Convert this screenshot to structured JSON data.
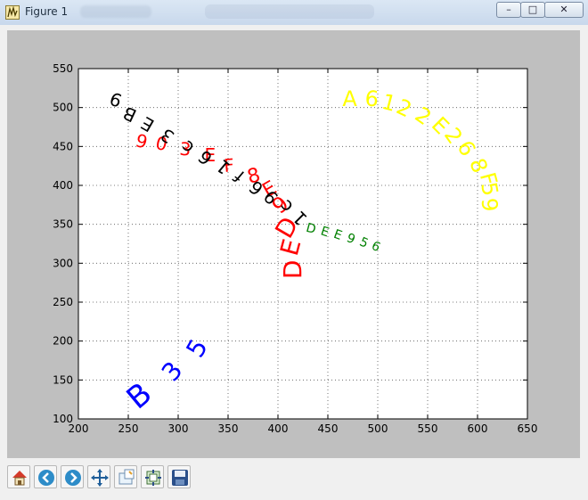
{
  "window": {
    "title": "Figure 1",
    "controls": {
      "minimize": "–",
      "maximize": "□",
      "close": "✕"
    }
  },
  "toolbar": {
    "buttons": [
      "home-icon",
      "back-icon",
      "forward-icon",
      "pan-icon",
      "zoom-icon",
      "subplots-icon",
      "save-icon"
    ]
  },
  "chart_data": {
    "type": "scatter",
    "xlim": [
      200,
      650
    ],
    "ylim": [
      100,
      550
    ],
    "xticks": [
      "200",
      "250",
      "300",
      "350",
      "400",
      "450",
      "500",
      "550",
      "600",
      "650"
    ],
    "yticks": [
      "100",
      "150",
      "200",
      "250",
      "300",
      "350",
      "400",
      "450",
      "500",
      "550"
    ],
    "grid": true,
    "text_series": [
      {
        "color": "#0000ff",
        "chars": [
          "B",
          "3",
          "5"
        ],
        "x": [
          262,
          295,
          320
        ],
        "y": [
          128,
          160,
          190
        ],
        "size": [
          34,
          28,
          28
        ],
        "rot": [
          -40,
          -50,
          -60
        ]
      },
      {
        "color": "#ff0000",
        "chars": [
          "9",
          "0",
          "3",
          "E",
          "F",
          "8",
          "E",
          "9",
          "D",
          "E",
          "D"
        ],
        "x": [
          263,
          283,
          307,
          332,
          351,
          376,
          392,
          403,
          410,
          414,
          416
        ],
        "y": [
          455,
          452,
          445,
          437,
          424,
          411,
          394,
          374,
          345,
          320,
          292
        ],
        "size": [
          20,
          20,
          20,
          20,
          20,
          22,
          22,
          24,
          28,
          28,
          28
        ],
        "rot": [
          15,
          12,
          5,
          0,
          -5,
          -15,
          -30,
          -40,
          -60,
          -75,
          -90
        ]
      },
      {
        "color": "#000000",
        "chars": [
          "9",
          "B",
          "E",
          "3",
          "c",
          "6",
          "1",
          "f",
          "6",
          "9",
          "c",
          "1"
        ],
        "x": [
          238,
          252,
          270,
          290,
          310,
          328,
          346,
          362,
          379,
          394,
          409,
          423
        ],
        "y": [
          512,
          493,
          480,
          465,
          450,
          437,
          425,
          413,
          398,
          386,
          374,
          359
        ],
        "size": [
          20,
          20,
          20,
          20,
          20,
          20,
          20,
          20,
          20,
          20,
          20,
          20
        ],
        "rot": [
          200,
          205,
          210,
          215,
          220,
          220,
          220,
          220,
          220,
          225,
          225,
          225
        ]
      },
      {
        "color": "#008000",
        "chars": [
          "D",
          "E",
          "E",
          "9",
          "5",
          "6"
        ],
        "x": [
          433,
          447,
          460,
          473,
          486,
          498
        ],
        "y": [
          344,
          340,
          336,
          331,
          326,
          321
        ],
        "size": [
          14,
          14,
          14,
          14,
          14,
          14
        ],
        "rot": [
          15,
          18,
          20,
          22,
          24,
          26
        ]
      },
      {
        "color": "#ffff00",
        "chars": [
          "A",
          "6",
          "1",
          "2",
          "2",
          "E",
          "2",
          "6",
          "8",
          "F",
          "5",
          "9"
        ],
        "x": [
          472,
          494,
          511,
          526,
          545,
          562,
          575,
          588,
          600,
          610,
          611,
          611
        ],
        "y": [
          510,
          510,
          505,
          498,
          488,
          476,
          463,
          447,
          425,
          408,
          395,
          375
        ],
        "size": [
          24,
          24,
          24,
          24,
          24,
          24,
          24,
          24,
          24,
          24,
          24,
          24
        ],
        "rot": [
          0,
          5,
          15,
          25,
          35,
          45,
          55,
          60,
          70,
          75,
          80,
          85
        ]
      }
    ]
  }
}
